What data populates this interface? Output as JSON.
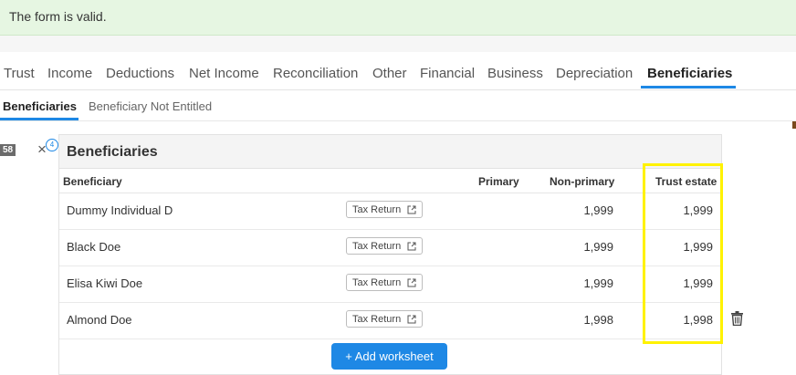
{
  "banner": {
    "message": "The form is valid."
  },
  "tabs": [
    {
      "label": "Trust"
    },
    {
      "label": "Income"
    },
    {
      "label": "Deductions"
    },
    {
      "label": "Net Income"
    },
    {
      "label": "Reconciliation"
    },
    {
      "label": "Other"
    },
    {
      "label": "Financial"
    },
    {
      "label": "Business"
    },
    {
      "label": "Depreciation"
    },
    {
      "label": "Beneficiaries",
      "active": true
    }
  ],
  "subtabs": [
    {
      "label": "Beneficiaries",
      "active": true
    },
    {
      "label": "Beneficiary Not Entitled"
    }
  ],
  "row_number": "58",
  "close_count": "4",
  "panel": {
    "title": "Beneficiaries",
    "columns": {
      "beneficiary": "Beneficiary",
      "primary": "Primary",
      "non_primary": "Non-primary",
      "trust_estate": "Trust estate"
    },
    "rows": [
      {
        "name": "Dummy Individual D",
        "button": "Tax Return",
        "non_primary": "1,999",
        "trust_estate": "1,999"
      },
      {
        "name": "Black Doe",
        "button": "Tax Return",
        "non_primary": "1,999",
        "trust_estate": "1,999"
      },
      {
        "name": "Elisa Kiwi Doe",
        "button": "Tax Return",
        "non_primary": "1,999",
        "trust_estate": "1,999"
      },
      {
        "name": "Almond Doe",
        "button": "Tax Return",
        "non_primary": "1,998",
        "trust_estate": "1,998"
      }
    ],
    "add_button": "+ Add worksheet"
  },
  "colors": {
    "accent": "#1e88e5",
    "success_bg": "#e6f6e2",
    "highlight": "#fff200"
  }
}
